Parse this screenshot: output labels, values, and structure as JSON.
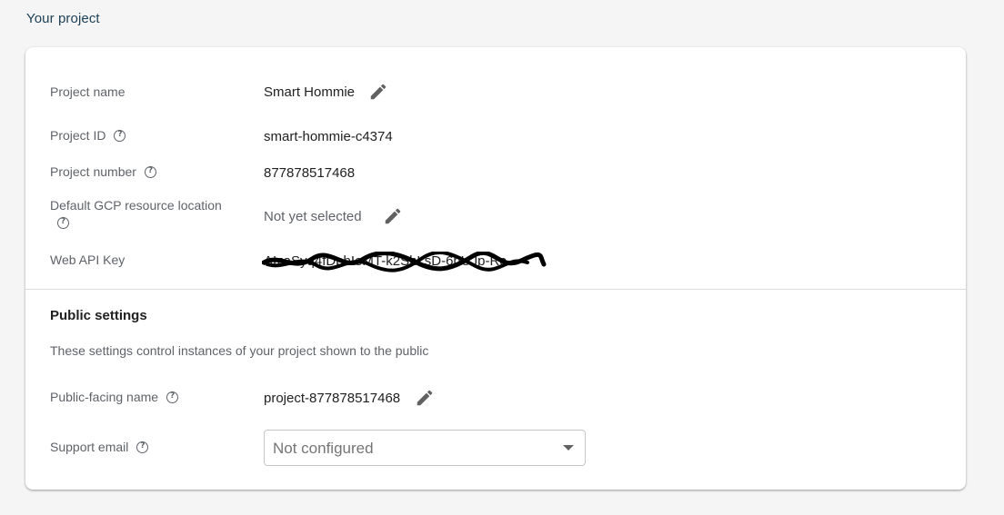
{
  "page": {
    "section_title": "Your project"
  },
  "project": {
    "name_label": "Project name",
    "name_value": "Smart Hommie",
    "id_label": "Project ID",
    "id_value": "smart-hommie-c4374",
    "number_label": "Project number",
    "number_value": "877878517468",
    "location_label": "Default GCP resource location",
    "location_value": "Not yet selected",
    "api_key_label": "Web API Key",
    "api_key_value": "AIzaSyq4fDpbIeMT-k2ShLsD-6hUJp-Rc"
  },
  "public_settings": {
    "title": "Public settings",
    "description": "These settings control instances of your project shown to the public",
    "public_name_label": "Public-facing name",
    "public_name_value": "project-877878517468",
    "support_email_label": "Support email",
    "support_email_value": "Not configured"
  },
  "icons": {
    "edit": "pencil-icon",
    "help": "help-circle-icon",
    "dropdown": "caret-down-icon"
  },
  "colors": {
    "section_title": "#1e4158",
    "label": "#5f6368",
    "scribble": "#000000"
  }
}
